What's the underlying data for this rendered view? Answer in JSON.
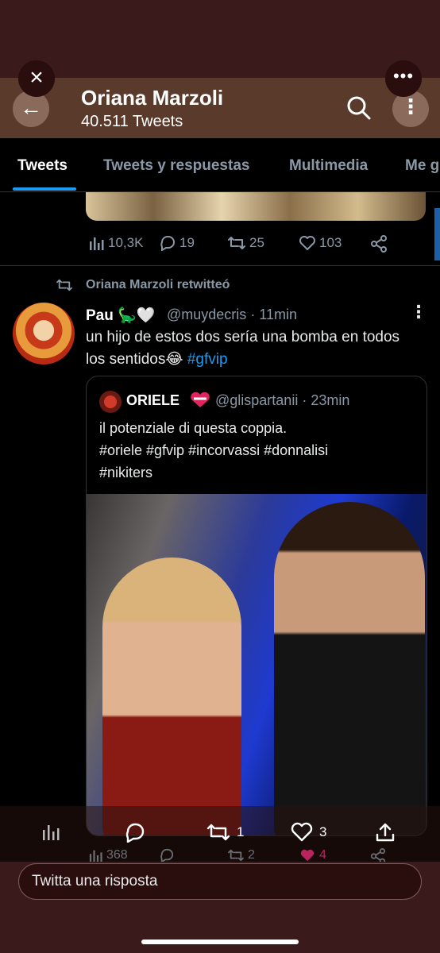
{
  "header": {
    "profile_name": "Oriana Marzoli",
    "tweet_count": "40.511 Tweets",
    "close_label": "×",
    "back_label": "←",
    "more_label": "⋮",
    "overflow_label": "•••"
  },
  "tabs": [
    "Tweets",
    "Tweets y respuestas",
    "Multimedia",
    "Me gusta"
  ],
  "previous_tweet": {
    "views": "10,3K",
    "replies": "19",
    "retweets": "25",
    "likes": "103"
  },
  "retweet_banner": "Oriana Marzoli retwitteó",
  "tweet": {
    "name": "Pau",
    "name_emoji": "🦕🤍",
    "handle": "@muydecris",
    "time": "· 11min",
    "text": "un hijo de estos dos sería una bomba en todos los sentidos😂",
    "hashtag": "#gfvip",
    "more_label": "⋮"
  },
  "quote": {
    "name": "ORIELE",
    "handle": "@glispartanii",
    "time": "· 23min",
    "text_line1": "il potenziale di questa coppia.",
    "text_line2": "#oriele #gfvip #incorvassi #donnalisi",
    "text_line3": "#nikiters"
  },
  "bottom_actions": {
    "retweets": "1",
    "likes": "3"
  },
  "under_row": {
    "views": "368",
    "retweets": "2",
    "likes": "4"
  },
  "reply": {
    "placeholder": "Twitta una risposta"
  },
  "colors": {
    "accent": "#1d9bf0",
    "like_active": "#f91880",
    "overlay": "#3a1a1a"
  }
}
